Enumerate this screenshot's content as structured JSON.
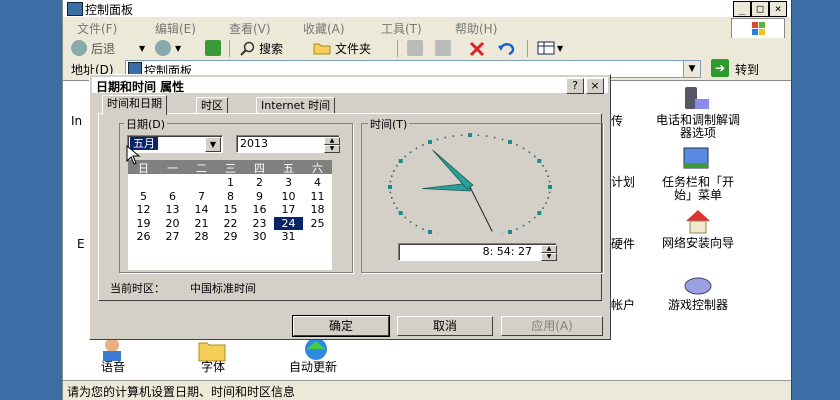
{
  "window": {
    "title": "控制面板",
    "caption_buttons": [
      "_",
      "□",
      "×"
    ]
  },
  "menubar": [
    "文件(F)",
    "编辑(E)",
    "查看(V)",
    "收藏(A)",
    "工具(T)",
    "帮助(H)"
  ],
  "toolbar": {
    "back": "后退",
    "search": "搜索",
    "folders": "文件夹"
  },
  "addressbar": {
    "label": "地址(D)",
    "value": "控制面板",
    "go": "转到"
  },
  "control_panel_items": {
    "i1": "电话和调制解调器选项",
    "i2": "任务栏和「开始」菜单",
    "i3": "网络安装向导",
    "i4": "游戏控制器",
    "i5": "语音",
    "i6": "字体",
    "i7": "自动更新"
  },
  "partial_labels": {
    "p1": "In",
    "p2": "E",
    "p3": "传",
    "p4": "计划",
    "p5": "硬件",
    "p6": "帐户"
  },
  "status": "请为您的计算机设置日期、时间和时区信息",
  "dialog": {
    "title": "日期和时间 属性",
    "caption_buttons": [
      "?",
      "×"
    ],
    "tabs": [
      "时间和日期",
      "时区",
      "Internet 时间"
    ],
    "date_group": "日期(D)",
    "month": "五月",
    "year": "2013",
    "weekdays": [
      "日",
      "一",
      "二",
      "三",
      "四",
      "五",
      "六"
    ],
    "weeks": [
      [
        "",
        "",
        "",
        "1",
        "2",
        "3",
        "4"
      ],
      [
        "5",
        "6",
        "7",
        "8",
        "9",
        "10",
        "11"
      ],
      [
        "12",
        "13",
        "14",
        "15",
        "16",
        "17",
        "18"
      ],
      [
        "19",
        "20",
        "21",
        "22",
        "23",
        "24",
        "25"
      ],
      [
        "26",
        "27",
        "28",
        "29",
        "30",
        "31",
        ""
      ]
    ],
    "selected_day": "24",
    "time_group": "时间(T)",
    "time": "8: 54: 27",
    "timezone_label": "当前时区：",
    "timezone_value": "中国标准时间",
    "ok": "确定",
    "cancel": "取消",
    "apply": "应用(A)"
  },
  "colors": {
    "desktop": "#3a6ea5",
    "selection": "#0a246a",
    "clock_ticks": "#1f8a8a",
    "clock_hands": "#2aa198"
  },
  "clock": {
    "hour": 8,
    "minute": 54,
    "second": 27
  }
}
